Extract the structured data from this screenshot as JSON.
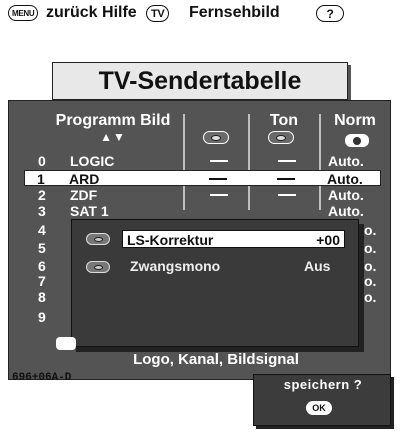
{
  "topbar": {
    "menu_key": "MENU",
    "zurueck_hilfe": "zurück Hilfe",
    "tv_key": "TV",
    "fernsehbild": "Fernsehbild",
    "help_key": "?"
  },
  "title": "TV-Sendertabelle",
  "table": {
    "headers": {
      "programm_bild": "Programm Bild",
      "sort_arrows": "▲▼",
      "ton": "Ton",
      "norm": "Norm"
    },
    "rows": [
      {
        "num": "0",
        "name": "LOGIC",
        "bild": "—",
        "ton": "—",
        "norm": "Auto."
      },
      {
        "num": "1",
        "name": "ARD",
        "bild": "—",
        "ton": "—",
        "norm": "Auto.",
        "selected": true
      },
      {
        "num": "2",
        "name": "ZDF",
        "bild": "—",
        "ton": "—",
        "norm": "Auto."
      },
      {
        "num": "3",
        "name": "SAT 1",
        "bild": "",
        "ton": "",
        "norm": "Auto."
      },
      {
        "num": "4",
        "name": "",
        "norm": "o."
      },
      {
        "num": "5",
        "name": "",
        "norm": "o."
      },
      {
        "num": "6",
        "name": "",
        "norm": "o."
      },
      {
        "num": "7",
        "name": "",
        "norm": "o."
      },
      {
        "num": "8",
        "name": "",
        "norm": "o."
      },
      {
        "num": "9",
        "name": "",
        "norm": ""
      }
    ]
  },
  "popup": {
    "ls_label": "LS-Korrektur",
    "ls_value": "+00",
    "zw_label": "Zwangsmono",
    "zw_value": "Aus"
  },
  "status": "Logo, Kanal, Bildsignal",
  "code": "696+06A-D",
  "save": {
    "label": "speichern ?",
    "ok_key": "OK"
  }
}
